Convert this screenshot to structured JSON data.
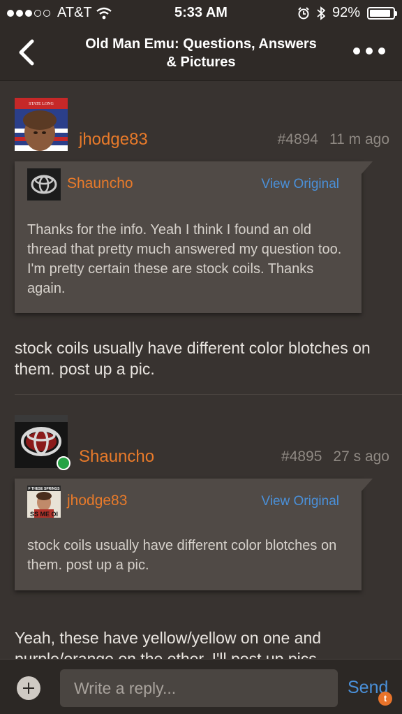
{
  "status": {
    "carrier": "AT&T",
    "time": "5:33 AM",
    "battery": "92%",
    "battery_level": 0.92
  },
  "nav": {
    "title_line1": "Old Man Emu: Questions, Answers",
    "title_line2": "& Pictures"
  },
  "posts": [
    {
      "author": "jhodge83",
      "number": "#4894",
      "age": "11 m ago",
      "quote": {
        "author": "Shauncho",
        "view_label": "View Original",
        "text": "Thanks for the info. Yeah I think I found an old thread that pretty much answered my question too. I'm pretty certain these are stock coils. Thanks again."
      },
      "body": "stock coils usually have different color blotches on them.  post up a pic."
    },
    {
      "author": "Shauncho",
      "number": "#4895",
      "age": "27 s ago",
      "quote": {
        "author": "jhodge83",
        "view_label": "View Original",
        "text": "stock coils usually have different color blotches on them.  post up a pic."
      },
      "body": "Yeah, these have yellow/yellow on one and purple/orange on the other. I'll post up pics"
    }
  ],
  "avatar_text": {
    "banner_top": "STATE LONG",
    "caption_line1": "F THESE SPRINGS",
    "caption_line2": "SS ME OI"
  },
  "reply": {
    "placeholder": "Write a reply...",
    "send_label": "Send",
    "badge": "t"
  },
  "colors": {
    "accent_orange": "#e87a2a",
    "link_blue": "#4a90d9",
    "online_green": "#25a244"
  }
}
